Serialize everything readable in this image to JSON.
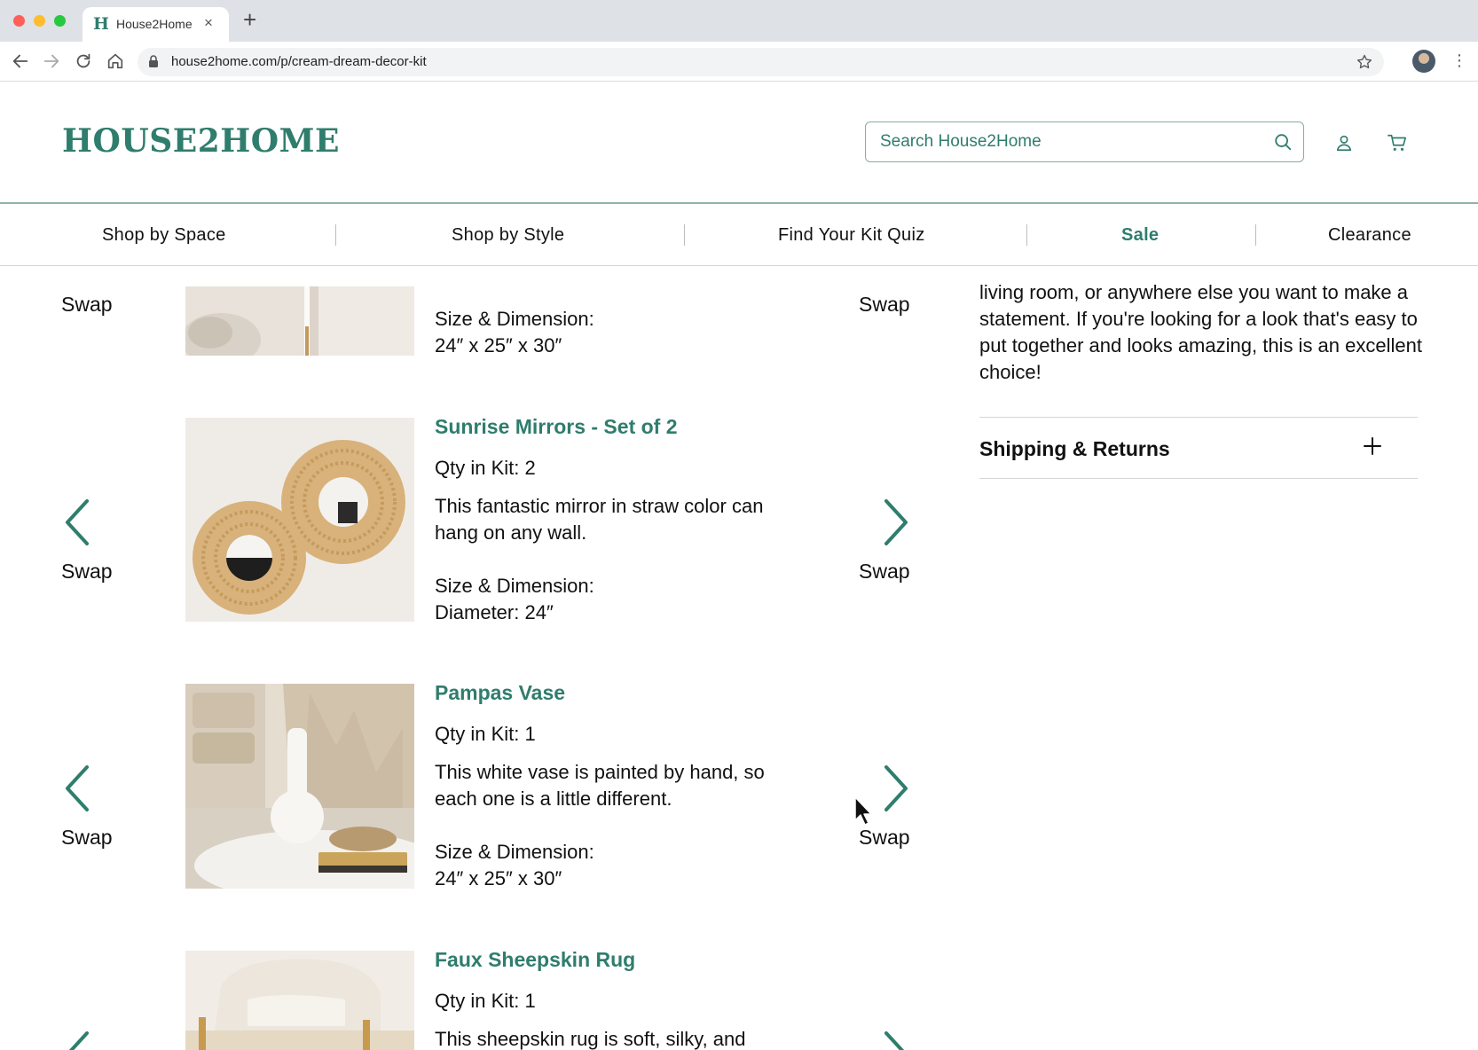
{
  "browser": {
    "tab_title": "House2Home",
    "favicon_letter": "H",
    "tab_close": "×",
    "new_tab": "+",
    "url": "house2home.com/p/cream-dream-decor-kit",
    "menu_glyph": "⋮"
  },
  "header": {
    "logo": "HOUSE2HOME",
    "search_placeholder": "Search House2Home"
  },
  "nav": {
    "items": [
      "Shop by Space",
      "Shop by Style",
      "Find Your Kit Quiz",
      "Sale",
      "Clearance"
    ],
    "highlight_color": "#2f7d6d"
  },
  "theme": {
    "accent": "#2f7d6d"
  },
  "swap_label": "Swap",
  "products": [
    {
      "title": "",
      "size_label": "Size & Dimension:",
      "size_value": "24″ x 25″ x 30″"
    },
    {
      "title": "Sunrise Mirrors - Set of 2",
      "qty": "Qty in Kit: 2",
      "description": "This fantastic mirror in straw color can hang on any wall.",
      "size_label": "Size & Dimension:",
      "size_value": "Diameter: 24″"
    },
    {
      "title": "Pampas Vase",
      "qty": "Qty in Kit: 1",
      "description": "This white vase is painted by hand, so each one is a little different.",
      "size_label": "Size & Dimension:",
      "size_value": "24″ x 25″ x 30″"
    },
    {
      "title": "Faux Sheepskin Rug",
      "qty": "Qty in Kit: 1",
      "description": "This sheepskin rug is soft, silky, and"
    }
  ],
  "sidebar": {
    "description": "living room, or anywhere else you want to make a statement. If you're looking for a look that's easy to put together and looks amazing, this is an excellent choice!",
    "shipping_title": "Shipping & Returns"
  }
}
